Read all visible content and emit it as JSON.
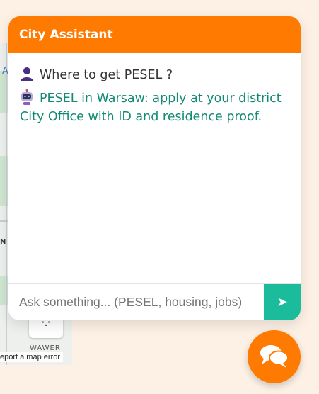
{
  "chat": {
    "title": "City Assistant",
    "messages": [
      {
        "sender": "user",
        "avatar_icon": "user-icon",
        "text": "Where to get PESEL ?"
      },
      {
        "sender": "bot",
        "avatar_icon": "robot-icon",
        "text": "PESEL in Warsaw: apply at your district City Office with ID and residence proof."
      }
    ],
    "input": {
      "placeholder": "Ask something... (PESEL, housing, jobs)",
      "value": ""
    },
    "send_icon": "send-arrow-icon",
    "colors": {
      "header": "#ff7a00",
      "bot_text": "#138a74",
      "send_button": "#1abc9c"
    }
  },
  "fab": {
    "icon": "chat-bubbles-icon"
  },
  "map": {
    "district_label": "WAWER",
    "report_link": "eport a map error",
    "letter_a": "A",
    "letter_n": "N"
  }
}
